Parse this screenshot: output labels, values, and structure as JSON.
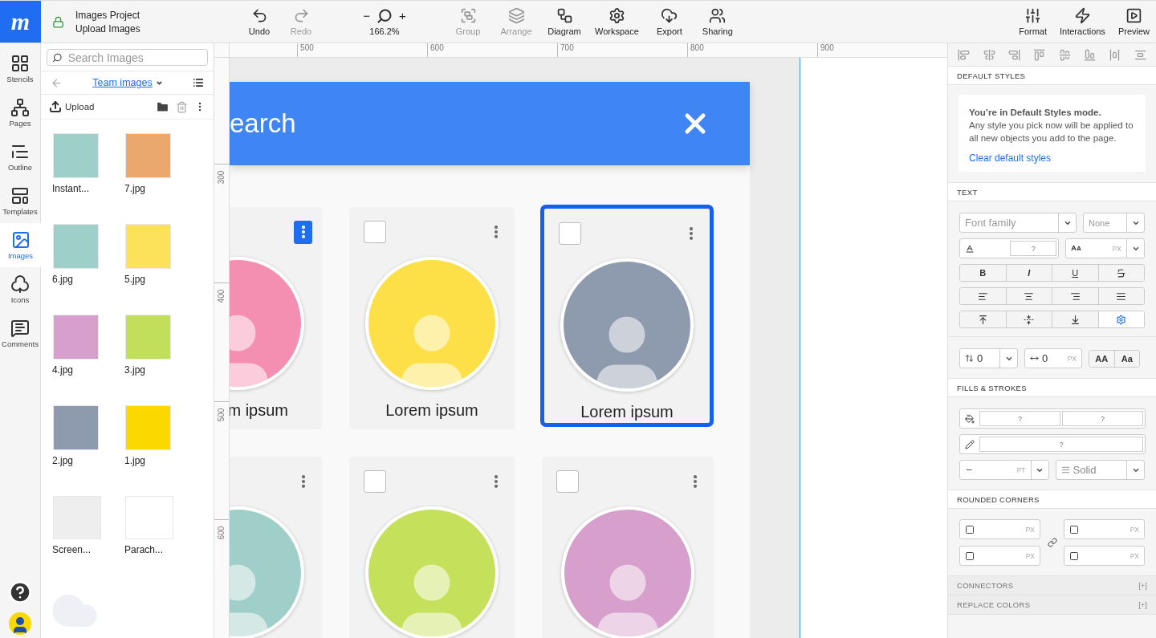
{
  "app": {
    "logo": "m",
    "project_title": "Images Project",
    "page_title": "Upload Images",
    "locked": true
  },
  "toolbar": [
    {
      "kind": "undo",
      "label": "Undo",
      "disabled": false
    },
    {
      "kind": "redo",
      "label": "Redo",
      "disabled": true
    }
  ],
  "zoom": {
    "minus": "−",
    "plus": "+",
    "value": "166.2%"
  },
  "tools": [
    {
      "kind": "group",
      "label": "Group",
      "disabled": true
    },
    {
      "kind": "arrange",
      "label": "Arrange",
      "disabled": true
    },
    {
      "kind": "diagram",
      "label": "Diagram",
      "disabled": false
    },
    {
      "kind": "workspace",
      "label": "Workspace",
      "disabled": false
    },
    {
      "kind": "export",
      "label": "Export",
      "disabled": false
    },
    {
      "kind": "sharing",
      "label": "Sharing",
      "disabled": false
    }
  ],
  "right_tools": [
    {
      "kind": "format",
      "label": "Format"
    },
    {
      "kind": "interactions",
      "label": "Interactions"
    },
    {
      "kind": "preview",
      "label": "Preview"
    }
  ],
  "rail": [
    {
      "kind": "stencils",
      "label": "Stencils",
      "selected": false
    },
    {
      "kind": "pages",
      "label": "Pages",
      "selected": false
    },
    {
      "kind": "outline",
      "label": "Outline",
      "selected": false
    },
    {
      "kind": "templates",
      "label": "Templates",
      "selected": false
    },
    {
      "kind": "images",
      "label": "Images",
      "selected": true
    },
    {
      "kind": "icons",
      "label": "Icons",
      "selected": false
    },
    {
      "kind": "comments",
      "label": "Comments",
      "selected": false
    }
  ],
  "images_panel": {
    "search": {
      "placeholder": "Search Images"
    },
    "folder": "Team images",
    "upload": "Upload",
    "items": [
      {
        "name": "Instant...",
        "color": "#9ecfc8"
      },
      {
        "name": "7.jpg",
        "color": "#eaa86c"
      },
      {
        "name": "6.jpg",
        "color": "#9ecfc8"
      },
      {
        "name": "5.jpg",
        "color": "#fbe25a"
      },
      {
        "name": "4.jpg",
        "color": "#d79fcb"
      },
      {
        "name": "3.jpg",
        "color": "#c2df5c"
      },
      {
        "name": "2.jpg",
        "color": "#8e9aae"
      },
      {
        "name": "1.jpg",
        "color": "#fbd800"
      },
      {
        "name": "Screen...",
        "color": "#eeeeee"
      },
      {
        "name": "Parach...",
        "color": "#ffffff"
      }
    ]
  },
  "rulers": {
    "horizontal": [
      "500",
      "600",
      "700",
      "800",
      "900"
    ],
    "vertical": [
      "300",
      "400",
      "500",
      "600"
    ]
  },
  "canvas": {
    "header_title": "earch",
    "cards": [
      {
        "label": "m ipsum",
        "menu_active": true,
        "selected": false,
        "color": "#f48fb1",
        "cut": true
      },
      {
        "label": "Lorem ipsum",
        "checked": false,
        "menu_active": false,
        "selected": false,
        "color": "#fde047",
        "cut": false
      },
      {
        "label": "Lorem ipsum",
        "checked": false,
        "menu_active": false,
        "selected": true,
        "color": "#8e9aae",
        "cut": false
      },
      {
        "menu_active": false,
        "selected": false,
        "color": "#9fcfc8",
        "cut": true
      },
      {
        "checked": false,
        "menu_active": false,
        "selected": false,
        "color": "#c5e15b",
        "cut": false
      },
      {
        "checked": false,
        "menu_active": false,
        "selected": false,
        "color": "#d79fcb",
        "cut": false
      }
    ]
  },
  "format_panel": {
    "default_styles": {
      "title": "DEFAULT STYLES",
      "heading": "You’re in Default Styles mode.",
      "body": "Any style you pick now will be applied to all new objects you add to the page.",
      "link": "Clear default styles"
    },
    "text": {
      "title": "TEXT",
      "font_family": {
        "placeholder": "Font family"
      },
      "weight": "None",
      "color_value": "?",
      "size_unit": "PX",
      "styles": [
        {
          "kind": "bold",
          "label": "B"
        },
        {
          "kind": "italic",
          "label": "I"
        },
        {
          "kind": "underline",
          "label": "U"
        },
        {
          "kind": "strike"
        }
      ],
      "aligns": [
        {
          "kind": "left",
          "selected": false
        },
        {
          "kind": "center",
          "selected": false
        },
        {
          "kind": "right",
          "selected": false
        },
        {
          "kind": "justify",
          "selected": false
        }
      ],
      "valigns": [
        {
          "kind": "top",
          "selected": false
        },
        {
          "kind": "middle",
          "selected": false
        },
        {
          "kind": "bottom",
          "selected": false
        },
        {
          "kind": "auto",
          "selected": true
        }
      ],
      "line_spacing": "0",
      "letter_spacing": "0",
      "letter_unit": "PX",
      "case_buttons": [
        "AA",
        "Aa"
      ]
    },
    "fills": {
      "title": "FILLS & STROKES",
      "fill_values": [
        "?",
        "?"
      ],
      "stroke_value": "?",
      "width_unit": "PT",
      "style": "Solid"
    },
    "corners": {
      "title": "ROUNDED CORNERS",
      "units": [
        "PX",
        "PX",
        "PX",
        "PX"
      ]
    },
    "collapsed": [
      {
        "title": "CONNECTORS",
        "toggle": "[+]"
      },
      {
        "title": "REPLACE COLORS",
        "toggle": "[+]"
      }
    ]
  }
}
